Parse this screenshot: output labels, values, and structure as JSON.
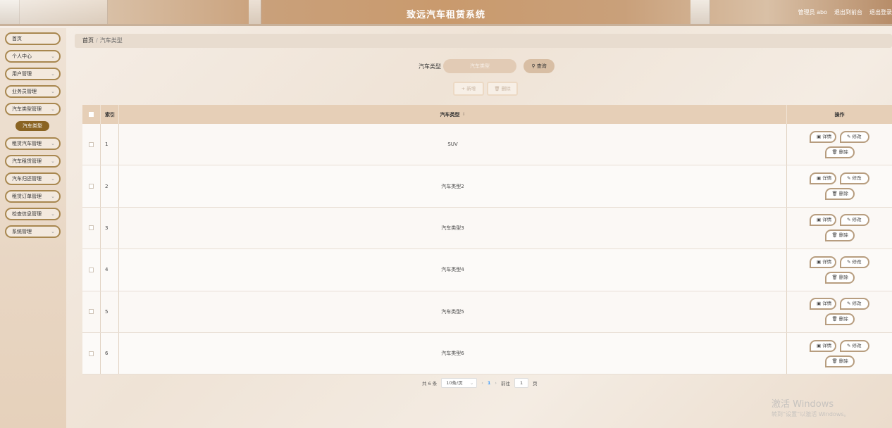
{
  "header": {
    "title": "致远汽车租赁系统",
    "user": "管理员 abo",
    "back_to_front": "退出到前台",
    "logout": "退出登录"
  },
  "sidebar": {
    "items": [
      {
        "label": "首页",
        "has_arrow": false
      },
      {
        "label": "个人中心",
        "has_arrow": true
      },
      {
        "label": "用户管理",
        "has_arrow": true
      },
      {
        "label": "业务员管理",
        "has_arrow": true
      },
      {
        "label": "汽车类型管理",
        "has_arrow": true
      },
      {
        "label": "租赁汽车管理",
        "has_arrow": true
      },
      {
        "label": "汽车租赁管理",
        "has_arrow": true
      },
      {
        "label": "汽车归还管理",
        "has_arrow": true
      },
      {
        "label": "租赁订单管理",
        "has_arrow": true
      },
      {
        "label": "检查信息管理",
        "has_arrow": true
      },
      {
        "label": "系统管理",
        "has_arrow": true
      }
    ],
    "active_sub": "汽车类型"
  },
  "breadcrumb": {
    "home": "首页",
    "separator": "/",
    "current": "汽车类型"
  },
  "search": {
    "label": "汽车类型",
    "placeholder": "汽车类型",
    "button": "查询"
  },
  "actions": {
    "add": "新增",
    "delete": "删除"
  },
  "table": {
    "headers": {
      "index": "索引",
      "type": "汽车类型",
      "ops": "操作"
    },
    "rows": [
      {
        "index": "1",
        "type": "SUV"
      },
      {
        "index": "2",
        "type": "汽车类型2"
      },
      {
        "index": "3",
        "type": "汽车类型3"
      },
      {
        "index": "4",
        "type": "汽车类型4"
      },
      {
        "index": "5",
        "type": "汽车类型5"
      },
      {
        "index": "6",
        "type": "汽车类型6"
      }
    ],
    "op_labels": {
      "detail": "详情",
      "edit": "修改",
      "delete": "删除"
    }
  },
  "pagination": {
    "total": "共 6 条",
    "page_size": "10条/页",
    "current_page": "1",
    "goto_label": "前往",
    "goto_value": "1",
    "page_suffix": "页"
  },
  "watermark": {
    "title": "激活 Windows",
    "subtitle": "转到“设置”以激活 Windows。"
  },
  "colors": {
    "accent": "#8a6423",
    "header": "#c99a6d",
    "table_head": "#e6cfb7"
  }
}
